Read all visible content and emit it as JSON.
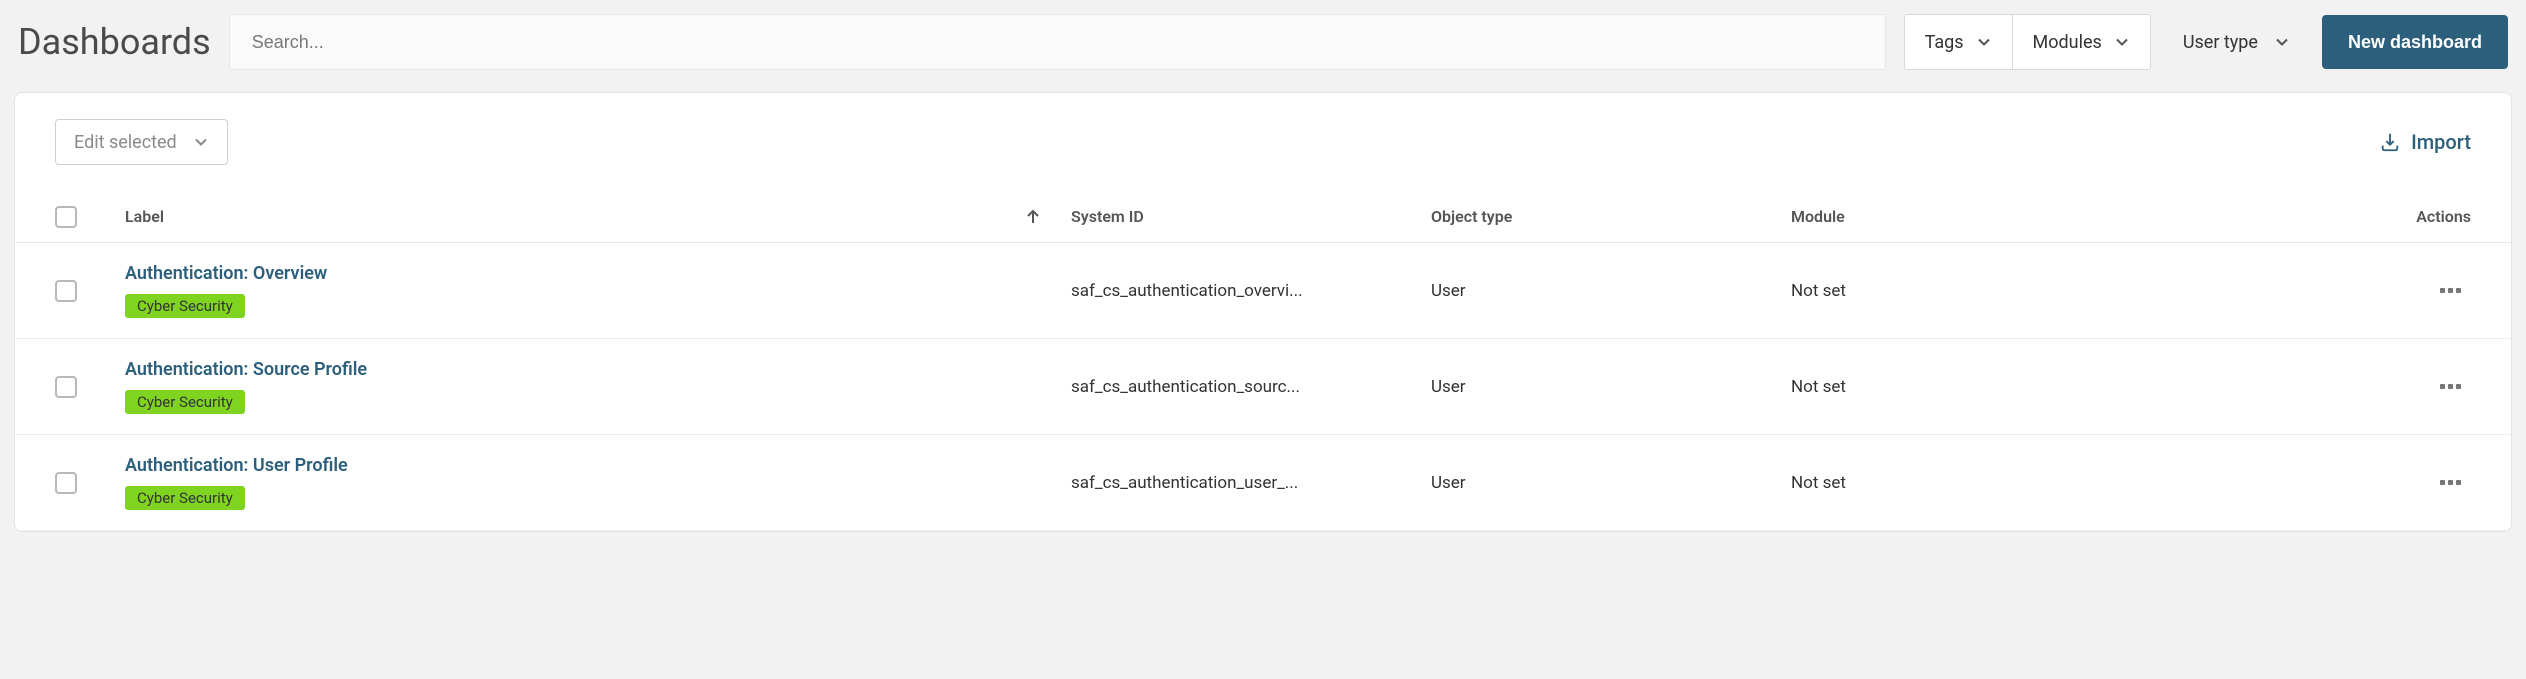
{
  "header": {
    "title": "Dashboards",
    "search_placeholder": "Search...",
    "tags_label": "Tags",
    "modules_label": "Modules",
    "user_type_label": "User type",
    "new_dashboard_label": "New dashboard"
  },
  "card": {
    "edit_selected_label": "Edit selected",
    "import_label": "Import"
  },
  "table": {
    "headers": {
      "label": "Label",
      "system_id": "System ID",
      "object_type": "Object type",
      "module": "Module",
      "actions": "Actions"
    },
    "rows": [
      {
        "label": "Authentication: Overview",
        "tag": "Cyber Security",
        "system_id": "saf_cs_authentication_overvi...",
        "object_type": "User",
        "module": "Not set"
      },
      {
        "label": "Authentication: Source Profile",
        "tag": "Cyber Security",
        "system_id": "saf_cs_authentication_sourc...",
        "object_type": "User",
        "module": "Not set"
      },
      {
        "label": "Authentication: User Profile",
        "tag": "Cyber Security",
        "system_id": "saf_cs_authentication_user_...",
        "object_type": "User",
        "module": "Not set"
      }
    ]
  }
}
